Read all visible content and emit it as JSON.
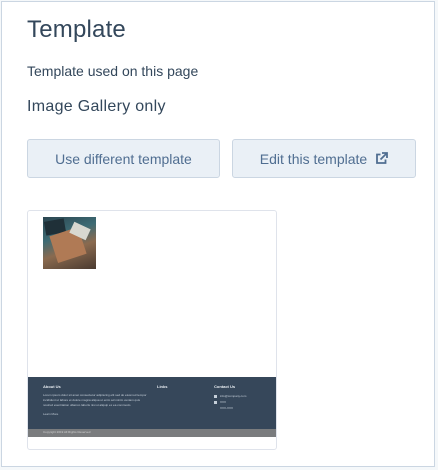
{
  "panel": {
    "title": "Template",
    "label": "Template used on this page",
    "value": "Image Gallery only"
  },
  "buttons": {
    "use_different": "Use different template",
    "edit": "Edit this template",
    "edit_icon": "external-link-icon"
  },
  "preview": {
    "footer": {
      "about_heading": "About Us",
      "about_text_1": "Lorem ipsum dolor sit amet consectetur adipiscing elit sed do eiusmod tempor",
      "about_text_2": "incididunt ut labore et dolore magna aliqua ut enim ad minim veniam quis",
      "about_text_3": "nostrud exercitation ullamco laboris nisi ut aliquip ex ea commodo",
      "about_link": "Learn More",
      "links_heading": "Links",
      "contact_heading": "Contact Us",
      "contact_email": "info@company.com",
      "contact_line_2": "XXX",
      "contact_line_3": "XXX-XXX"
    },
    "bottom_bar": "Copyright 2019 All Rights Reserved"
  },
  "colors": {
    "accent": "#506e91",
    "button_bg": "#eaf0f6",
    "footer_bg": "#36475a"
  }
}
